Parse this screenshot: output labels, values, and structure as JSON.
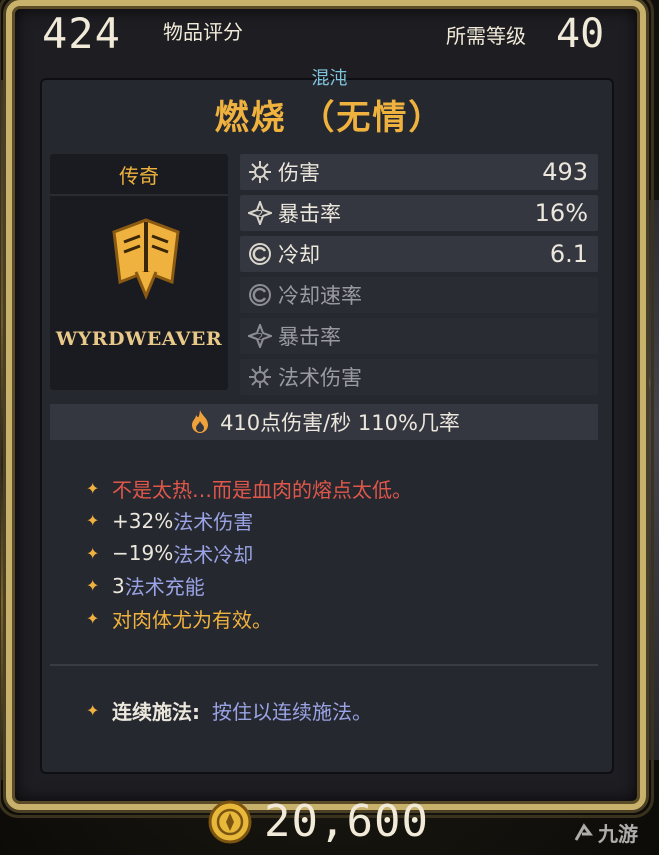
{
  "header": {
    "item_score": "424",
    "item_score_label": "物品评分",
    "level_label": "所需等级",
    "level_value": "40"
  },
  "item": {
    "element": "混沌",
    "name": "燃烧 （无情）",
    "rarity": "传奇",
    "brand": "WYRDWEAVER"
  },
  "stats": [
    {
      "label": "伤害",
      "value": "493",
      "icon": "sun-burst-icon",
      "active": true
    },
    {
      "label": "暴击率",
      "value": "16%",
      "icon": "crit-icon",
      "active": true
    },
    {
      "label": "冷却",
      "value": "6.1",
      "icon": "cooldown-icon",
      "active": true
    },
    {
      "label": "冷却速率",
      "value": "",
      "icon": "cooldown-icon",
      "active": false
    },
    {
      "label": "暴击率",
      "value": "",
      "icon": "crit-icon",
      "active": false
    },
    {
      "label": "法术伤害",
      "value": "",
      "icon": "sun-burst-icon",
      "active": false
    }
  ],
  "dps": {
    "text": "410点伤害/秒  110%几率",
    "icon": "fire-icon"
  },
  "effects": [
    {
      "text": "不是太热…而是血肉的熔点太低。"
    },
    {
      "num": "+32%",
      "text": "法术伤害"
    },
    {
      "num": "−19%",
      "text": "法术冷却"
    },
    {
      "num": "3",
      "text": "法术充能"
    },
    {
      "text": "对肉体尤为有效。"
    }
  ],
  "channel": {
    "label": "连续施法:",
    "desc": "按住以连续施法。"
  },
  "price": {
    "value": "20,600",
    "icon": "coin-icon"
  },
  "watermark": {
    "text": "九游"
  },
  "colors": {
    "accent_gold": "#f0b23e",
    "element_blue": "#7fc4dd",
    "lore_red": "#e0574a",
    "stat_blue": "#9aa3e3"
  }
}
